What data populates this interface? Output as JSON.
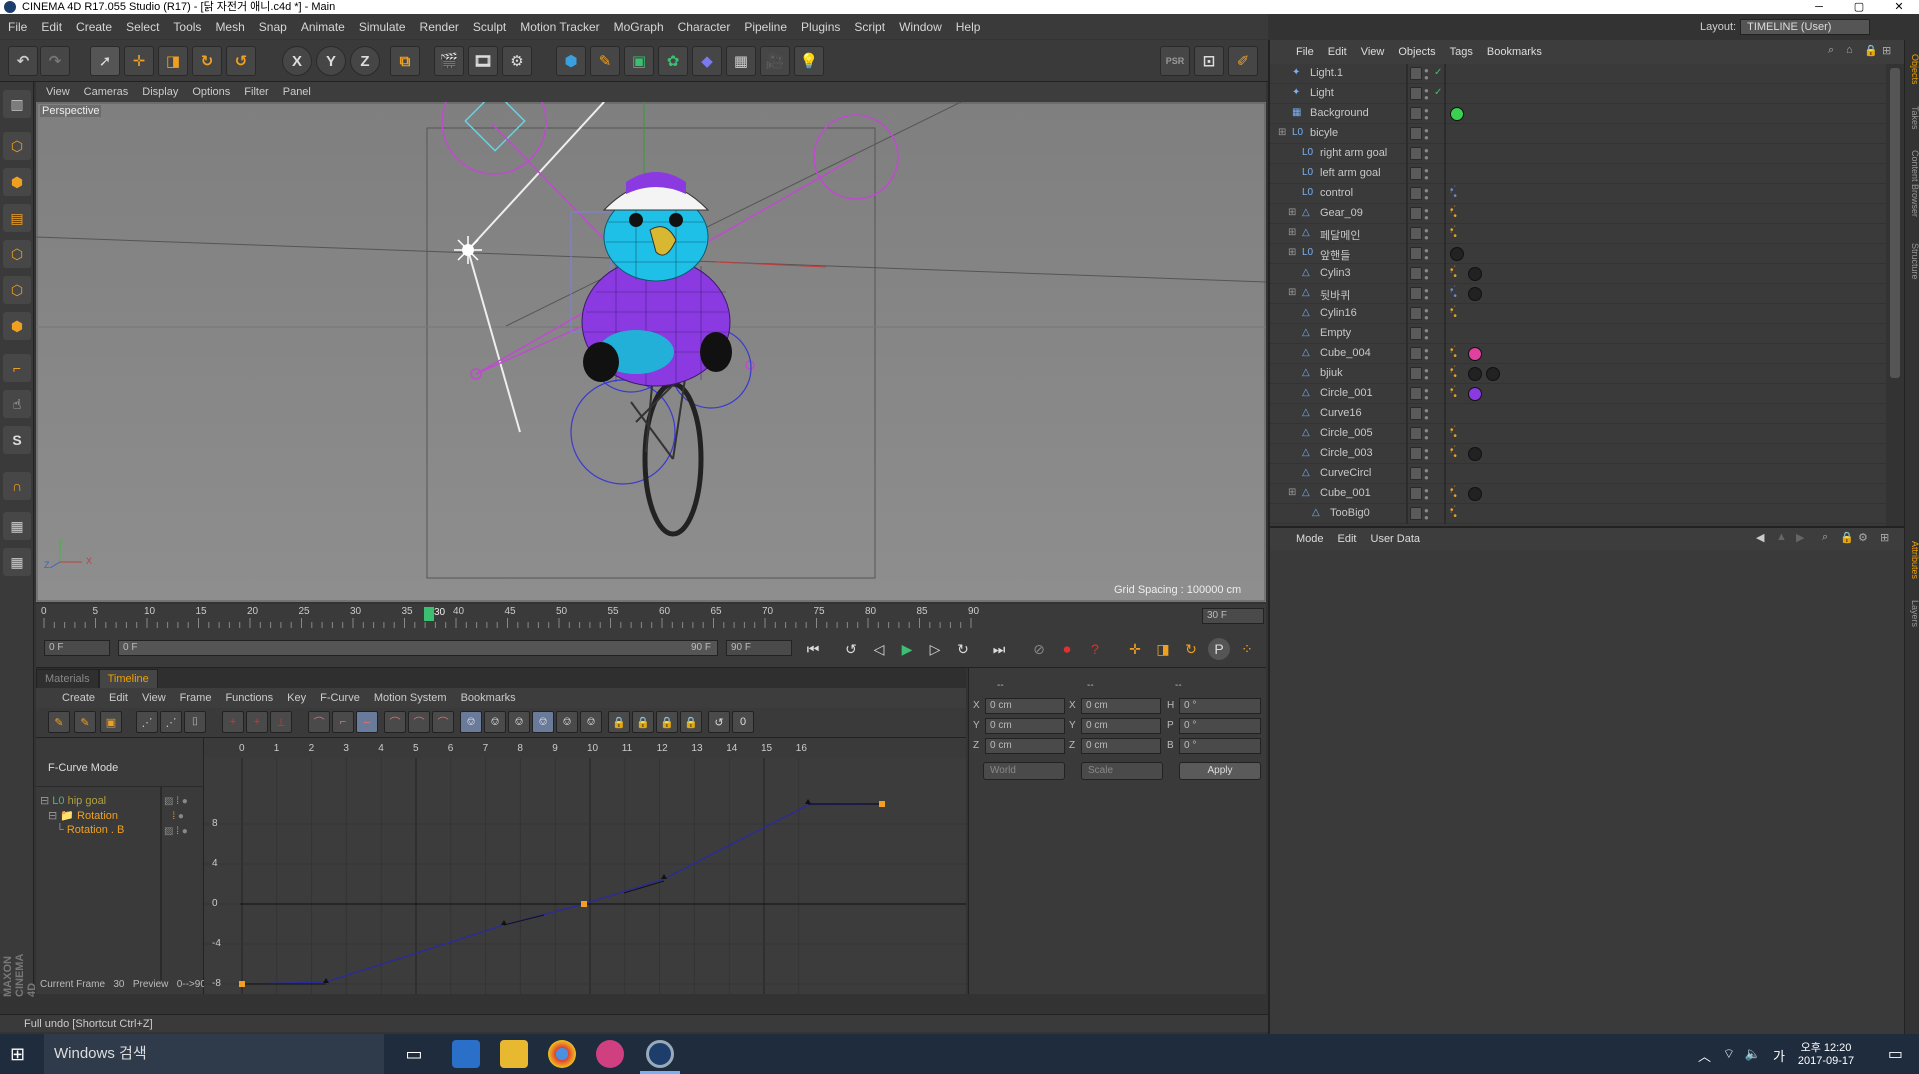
{
  "window": {
    "title": "CINEMA 4D R17.055 Studio (R17) - [닭 자전거 애니.c4d *] - Main",
    "minimize": "─",
    "maximize": "▢",
    "close": "✕"
  },
  "menu": [
    "File",
    "Edit",
    "Create",
    "Select",
    "Tools",
    "Mesh",
    "Snap",
    "Animate",
    "Simulate",
    "Render",
    "Sculpt",
    "Motion Tracker",
    "MoGraph",
    "Character",
    "Pipeline",
    "Plugins",
    "Script",
    "Window",
    "Help"
  ],
  "layout": {
    "label": "Layout:",
    "value": "TIMELINE (User)"
  },
  "toolbar": {
    "x": "X",
    "y": "Y",
    "z": "Z",
    "psr": "PSR"
  },
  "lefttools": {
    "s": "S"
  },
  "viewport": {
    "menu": [
      "View",
      "Cameras",
      "Display",
      "Options",
      "Filter",
      "Panel"
    ],
    "label": "Perspective",
    "grid_spacing": "Grid Spacing : 100000 cm",
    "axis_y": "Y",
    "axis_x": "X",
    "axis_z": "Z"
  },
  "timeline_ruler": {
    "ticks": [
      "0",
      "5",
      "10",
      "15",
      "20",
      "25",
      "30",
      "35",
      "40",
      "45",
      "50",
      "55",
      "60",
      "65",
      "70",
      "75",
      "80",
      "85",
      "90"
    ],
    "current": "30",
    "end_field": "30 F"
  },
  "timeline_ctrl": {
    "start": "0 F",
    "range_start": "0 F",
    "range_end": "90 F",
    "end": "90 F"
  },
  "tabs": [
    "Materials",
    "Timeline"
  ],
  "tl_menu": [
    "Create",
    "Edit",
    "View",
    "Frame",
    "Functions",
    "Key",
    "F-Curve",
    "Motion System",
    "Bookmarks"
  ],
  "tl_left": {
    "mode": "F-Curve Mode",
    "tracks": [
      "hip goal",
      "Rotation",
      "Rotation . B"
    ],
    "current_frame_label": "Current Frame",
    "current_frame": "30",
    "preview_label": "Preview",
    "preview": "0-->90"
  },
  "graph": {
    "x_ticks": [
      "0",
      "1",
      "2",
      "3",
      "4",
      "5",
      "6",
      "7",
      "8",
      "9",
      "10",
      "11",
      "12",
      "13",
      "14",
      "15",
      "16"
    ],
    "y_ticks": [
      "8",
      "4",
      "0",
      "-4",
      "-8"
    ],
    "tool_zero": "0"
  },
  "coords": {
    "headers": [
      "--",
      "--",
      "--"
    ],
    "rows": [
      {
        "a": "X",
        "av": "0 cm",
        "b": "X",
        "bv": "0 cm",
        "c": "H",
        "cv": "0 °"
      },
      {
        "a": "Y",
        "av": "0 cm",
        "b": "Y",
        "bv": "0 cm",
        "c": "P",
        "cv": "0 °"
      },
      {
        "a": "Z",
        "av": "0 cm",
        "b": "Z",
        "bv": "0 cm",
        "c": "B",
        "cv": "0 °"
      }
    ],
    "world": "World",
    "scale": "Scale",
    "apply": "Apply"
  },
  "status": "Full undo [Shortcut Ctrl+Z]",
  "objects": {
    "menu": [
      "File",
      "Edit",
      "View",
      "Objects",
      "Tags",
      "Bookmarks"
    ],
    "items": [
      {
        "name": "Light.1",
        "indent": 0
      },
      {
        "name": "Light",
        "indent": 0
      },
      {
        "name": "Background",
        "indent": 0
      },
      {
        "name": "bicyle",
        "indent": 0
      },
      {
        "name": "right arm goal",
        "indent": 1
      },
      {
        "name": "left arm goal",
        "indent": 1
      },
      {
        "name": "control",
        "indent": 1
      },
      {
        "name": "Gear_09",
        "indent": 1
      },
      {
        "name": "페달메인",
        "indent": 1
      },
      {
        "name": "앞핸들",
        "indent": 1
      },
      {
        "name": "Cylin3",
        "indent": 1
      },
      {
        "name": "뒷바퀴",
        "indent": 1
      },
      {
        "name": "Cylin16",
        "indent": 1
      },
      {
        "name": "Empty",
        "indent": 1
      },
      {
        "name": "Cube_004",
        "indent": 1
      },
      {
        "name": "bjiuk",
        "indent": 1
      },
      {
        "name": "Circle_001",
        "indent": 1
      },
      {
        "name": "Curve16",
        "indent": 1
      },
      {
        "name": "Circle_005",
        "indent": 1
      },
      {
        "name": "Circle_003",
        "indent": 1
      },
      {
        "name": "CurveCircl",
        "indent": 1
      },
      {
        "name": "Cube_001",
        "indent": 1
      },
      {
        "name": "TooBig0",
        "indent": 2
      }
    ]
  },
  "attributes": {
    "menu": [
      "Mode",
      "Edit",
      "User Data"
    ]
  },
  "side_tabs": [
    "Objects",
    "Takes",
    "Content Browser",
    "Structure",
    "Attributes",
    "Layers"
  ],
  "brand": "MAXON CINEMA 4D",
  "taskbar": {
    "search": "Windows 검색",
    "time": "오후 12:20",
    "date": "2017-09-17",
    "ime": "가"
  },
  "colors": {
    "accent": "#f0a000",
    "panel": "#3a3a3a",
    "viewport": "#8a8a8a",
    "taskbar": "#1f2c3d"
  }
}
